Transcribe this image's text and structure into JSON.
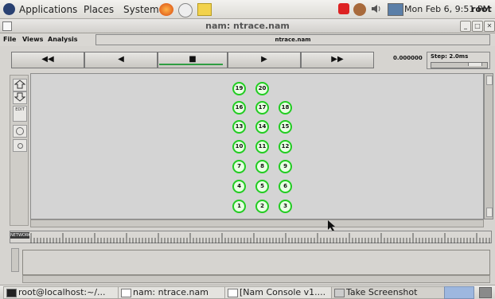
{
  "top_panel": {
    "menus": [
      "Applications",
      "Places",
      "System"
    ],
    "clock": "Mon Feb  6,  9:51 PM",
    "user": "root"
  },
  "window": {
    "title": "nam: ntrace.nam",
    "menu": [
      "File",
      "Views",
      "Analysis"
    ],
    "file_label": "ntrace.nam",
    "time": "0.000000",
    "step": "Step: 2.0ms"
  },
  "controls": [
    "◀◀",
    "◀",
    "■",
    "▶",
    "▶▶"
  ],
  "tools": [
    "EDIT"
  ],
  "timeline_label": "NETWORK",
  "nodes": [
    {
      "id": "19"
    },
    {
      "id": "20"
    },
    {
      "id": "16"
    },
    {
      "id": "17"
    },
    {
      "id": "18"
    },
    {
      "id": "13"
    },
    {
      "id": "14"
    },
    {
      "id": "15"
    },
    {
      "id": "10"
    },
    {
      "id": "11"
    },
    {
      "id": "12"
    },
    {
      "id": "7"
    },
    {
      "id": "8"
    },
    {
      "id": "9"
    },
    {
      "id": "4"
    },
    {
      "id": "5"
    },
    {
      "id": "6"
    },
    {
      "id": "1"
    },
    {
      "id": "2"
    },
    {
      "id": "3"
    }
  ],
  "taskbar": {
    "items": [
      "root@localhost:~/...",
      "nam: ntrace.nam",
      "[Nam Console v1....",
      "Take Screenshot"
    ]
  },
  "colors": {
    "node_border": "#22cc22",
    "node_fill": "#e9ffe4",
    "play_indicator": "#2f9e43"
  }
}
